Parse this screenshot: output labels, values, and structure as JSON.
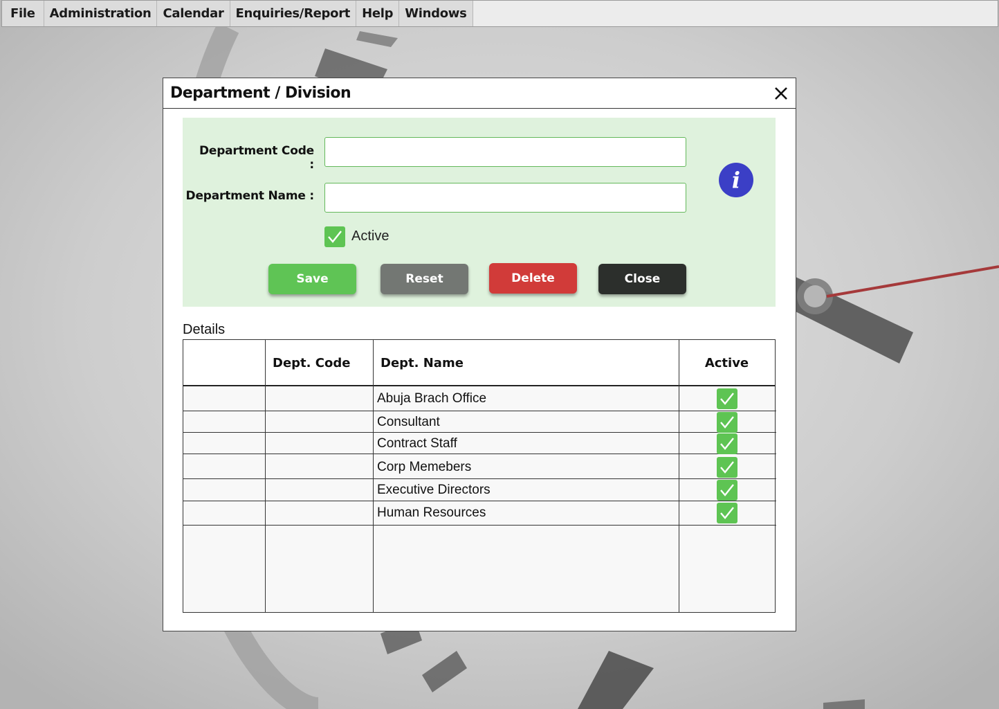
{
  "menu": {
    "items": [
      "File",
      "Administration",
      "Calendar",
      "Enquiries/Report",
      "Help",
      "Windows"
    ]
  },
  "dialog": {
    "title": "Department / Division",
    "form": {
      "code_label": "Department Code :",
      "code_value": "",
      "name_label": "Department Name :",
      "name_value": "",
      "active_label": "Active",
      "active_checked": true
    },
    "buttons": {
      "save": "Save",
      "reset": "Reset",
      "delete": "Delete",
      "close": "Close"
    },
    "details": {
      "label": "Details",
      "columns": [
        "",
        "Dept. Code",
        "Dept. Name",
        "Active"
      ],
      "rows": [
        {
          "code": "",
          "name": "Abuja Brach Office",
          "active": true
        },
        {
          "code": "",
          "name": "Consultant",
          "active": true
        },
        {
          "code": "",
          "name": "Contract Staff",
          "active": true
        },
        {
          "code": "",
          "name": "Corp Memebers",
          "active": true
        },
        {
          "code": "",
          "name": "Executive Directors",
          "active": true
        },
        {
          "code": "",
          "name": "Human Resources",
          "active": true
        }
      ]
    }
  },
  "colors": {
    "save": "#5fc455",
    "reset": "#737773",
    "delete": "#d13b39",
    "close": "#2c2f2c",
    "panel": "#dff2dd",
    "check": "#5ec453",
    "info": "#3b3fc6"
  }
}
